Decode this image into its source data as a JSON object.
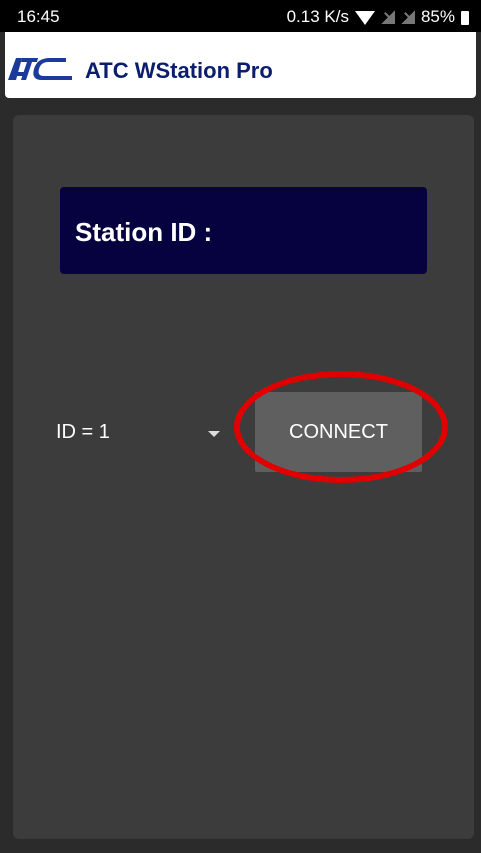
{
  "status_bar": {
    "time": "16:45",
    "speed": "0.13 K/s",
    "battery": "85%",
    "icons": [
      "wifi-icon",
      "no-signal-icon",
      "no-signal-icon",
      "battery-icon"
    ]
  },
  "app_bar": {
    "logo": "ATC",
    "title": "ATC WStation Pro"
  },
  "main": {
    "station_label": "Station ID :",
    "id_select_value": "ID = 1",
    "connect_label": "CONNECT"
  },
  "colors": {
    "accent_red": "#e00000",
    "station_box": "#060240",
    "title_blue": "#0b1e6e"
  }
}
